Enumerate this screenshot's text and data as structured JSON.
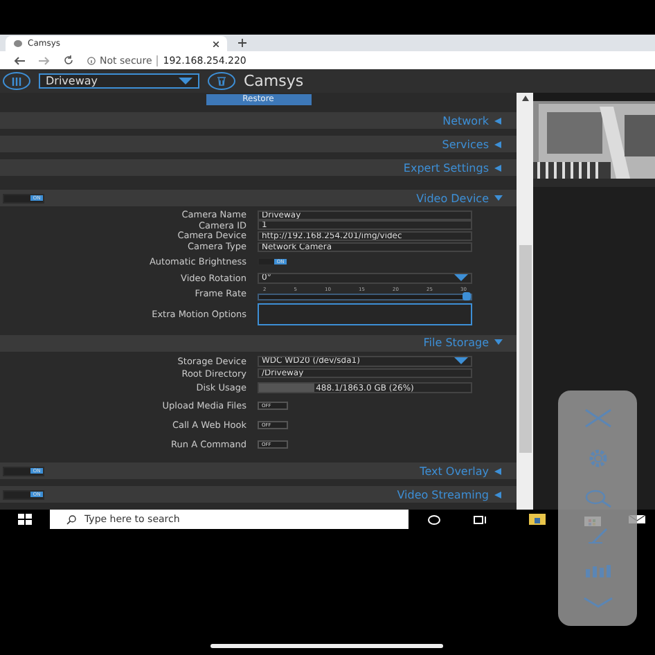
{
  "browser": {
    "tab_title": "Camsys",
    "security": "Not secure",
    "url": "192.168.254.220"
  },
  "header": {
    "camera_select": "Driveway",
    "title": "Camsys"
  },
  "restore_button": "Restore",
  "sections": [
    {
      "title": "Network",
      "expanded": false
    },
    {
      "title": "Services",
      "expanded": false
    },
    {
      "title": "Expert Settings",
      "expanded": false
    },
    {
      "title": "Video Device",
      "expanded": true,
      "toggle": {
        "text": "ON",
        "on": true
      },
      "fields": [
        {
          "kind": "text",
          "label": "Camera Name",
          "value": "Driveway"
        },
        {
          "kind": "text",
          "label": "Camera ID",
          "value": "1"
        },
        {
          "kind": "text",
          "label": "Camera Device",
          "value": "http://192.168.254.201/img/videc"
        },
        {
          "kind": "text",
          "label": "Camera Type",
          "value": "Network Camera"
        },
        {
          "kind": "toggle",
          "label": "Automatic Brightness",
          "text": "ON",
          "on": true
        },
        {
          "kind": "select",
          "label": "Video Rotation",
          "value": "0°"
        },
        {
          "kind": "slider",
          "label": "Frame Rate",
          "ticks": [
            "2",
            "5",
            "10",
            "15",
            "20",
            "25",
            "30"
          ],
          "level": 1.0
        },
        {
          "kind": "textarea",
          "label": "Extra Motion Options"
        }
      ]
    },
    {
      "title": "File Storage",
      "expanded": true,
      "fields": [
        {
          "kind": "select",
          "label": "Storage Device",
          "value": "WDC WD20 (/dev/sda1)"
        },
        {
          "kind": "text",
          "label": "Root Directory",
          "value": "/Driveway"
        },
        {
          "kind": "meter",
          "label": "Disk Usage",
          "value": "488.1/1863.0 GB (26%)",
          "level": 0.26
        },
        {
          "kind": "toggle",
          "label": "Upload Media Files",
          "text": "OFF",
          "on": false
        },
        {
          "kind": "toggle",
          "label": "Call A Web Hook",
          "text": "OFF",
          "on": false
        },
        {
          "kind": "toggle",
          "label": "Run A Command",
          "text": "OFF",
          "on": false
        }
      ]
    },
    {
      "title": "Text Overlay",
      "expanded": false,
      "toggle": {
        "text": "ON",
        "on": true
      }
    },
    {
      "title": "Video Streaming",
      "expanded": false,
      "toggle": {
        "text": "ON",
        "on": true
      }
    }
  ],
  "taskbar": {
    "search_placeholder": "Type here to search"
  }
}
